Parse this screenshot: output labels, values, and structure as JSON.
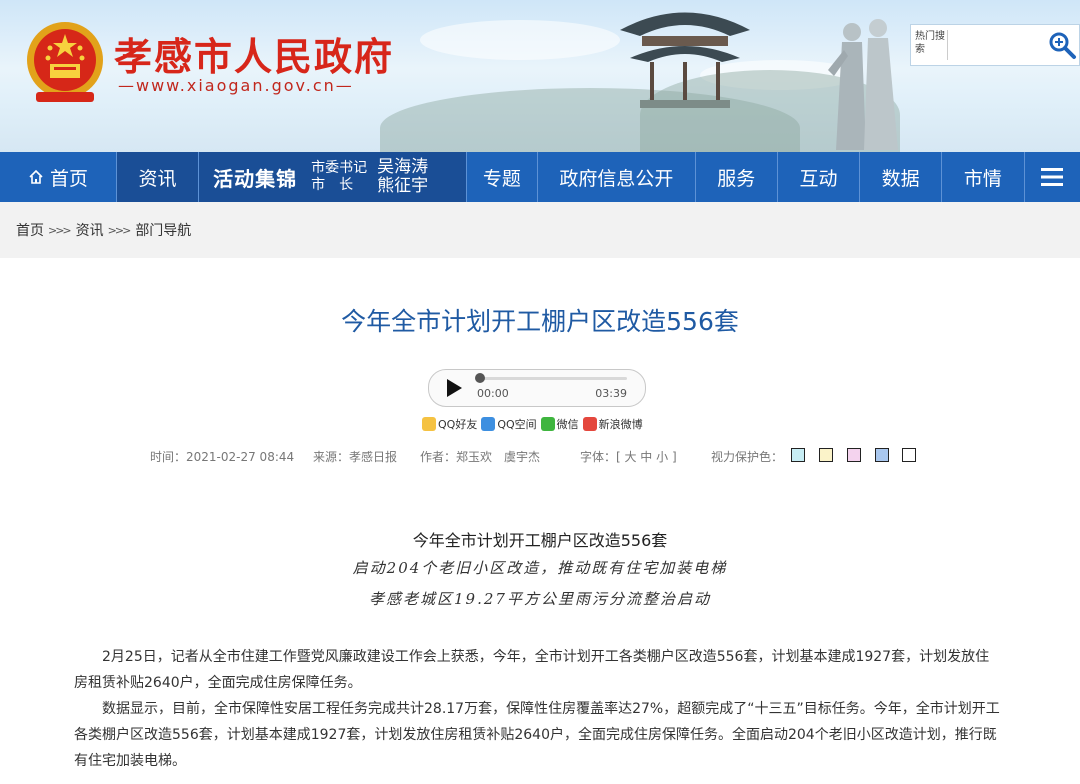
{
  "site": {
    "title": "孝感市人民政府",
    "url": "—www.xiaogan.gov.cn—",
    "search_hot_label": "热门搜索",
    "search_placeholder": ""
  },
  "nav": {
    "home": "首页",
    "news": "资讯",
    "activity_title": "活动集锦",
    "activity_roles": [
      "市委书记",
      "市　长"
    ],
    "activity_names": [
      "吴海涛",
      "熊征宇"
    ],
    "items": [
      "专题",
      "政府信息公开",
      "服务",
      "互动",
      "数据",
      "市情"
    ]
  },
  "breadcrumb": [
    "首页",
    "资讯",
    "部门导航"
  ],
  "breadcrumb_sep": ">>>",
  "article": {
    "title": "今年全市计划开工棚户区改造556套",
    "audio": {
      "current": "00:00",
      "total": "03:39",
      "progress": 0
    },
    "share": [
      "QQ好友",
      "QQ空间",
      "微信",
      "新浪微博"
    ],
    "meta": {
      "time": "时间：2021-02-27 08:44",
      "source": "来源：孝感日报",
      "author": "作者：郑玉欢　虞宇杰",
      "font": "字体：[ 大 中 小 ]",
      "vision": "视力保护色："
    },
    "subheads": [
      "今年全市计划开工棚户区改造556套",
      "启动204个老旧小区改造，推动既有住宅加装电梯",
      "孝感老城区19.27平方公里雨污分流整治启动"
    ],
    "paragraphs": [
      "2月25日，记者从全市住建工作暨党风廉政建设工作会上获悉，今年，全市计划开工各类棚户区改造556套，计划基本建成1927套，计划发放住房租赁补贴2640户，全面完成住房保障任务。",
      "数据显示，目前，全市保障性安居工程任务完成共计28.17万套，保障性住房覆盖率达27%，超额完成了“十三五”目标任务。今年，全市计划开工各类棚户区改造556套，计划基本建成1927套，计划发放住房租赁补贴2640户，全面完成住房保障任务。全面启动204个老旧小区改造计划，推行既有住宅加装电梯。"
    ]
  },
  "colors": {
    "nav_bg": "#1e63b9",
    "nav_active": "#1a4e96",
    "title_red": "#d7261a",
    "article_title": "#1f5aa3",
    "swatches": [
      "#c7edf4",
      "#fbf3c9",
      "#f4d3ee",
      "#a9c7ee",
      "#ffffff"
    ]
  }
}
